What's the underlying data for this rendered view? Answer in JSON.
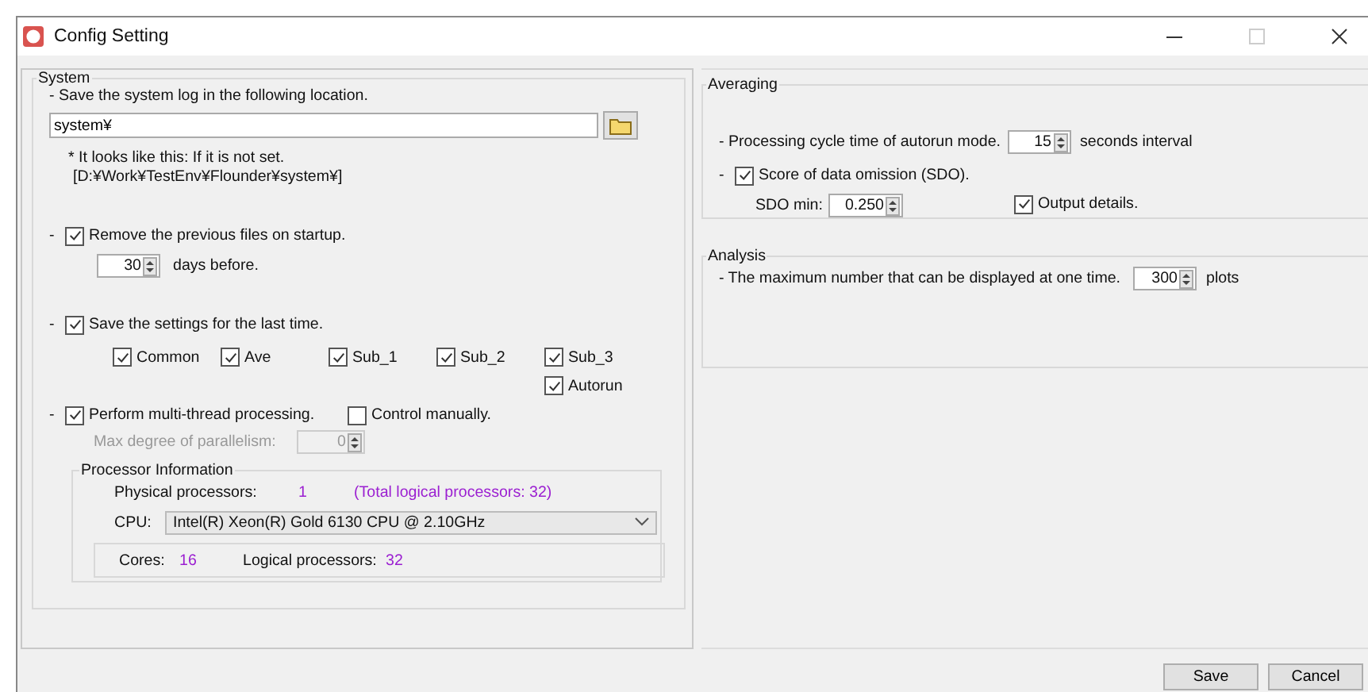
{
  "window": {
    "title": "Config Setting"
  },
  "system": {
    "title": "System",
    "log_label": "- Save the system log in the following location.",
    "log_path": "system¥",
    "note": [
      "* It looks like this: If it is not set.",
      "[D:¥Work¥TestEnv¥Flounder¥system¥]"
    ],
    "dash": "-",
    "remove_previous": {
      "label": "Remove the previous files on startup.",
      "checked": true
    },
    "days": {
      "value": "30",
      "label": "days before."
    },
    "save_settings": {
      "label": "Save the settings for the last time.",
      "checked": true
    },
    "save_items": [
      {
        "label": "Common",
        "checked": true
      },
      {
        "label": "Ave",
        "checked": true
      },
      {
        "label": "Sub_1",
        "checked": true
      },
      {
        "label": "Sub_2",
        "checked": true
      },
      {
        "label": "Sub_3",
        "checked": true
      },
      {
        "label": "Autorun",
        "checked": true
      }
    ],
    "multi_thread": {
      "label": "Perform multi-thread processing.",
      "checked": true
    },
    "control_manually": {
      "label": "Control manually.",
      "checked": false
    },
    "max_parallel": {
      "label": "Max degree of parallelism:",
      "value": "0",
      "disabled": true
    },
    "processor_info": {
      "title": "Processor Information",
      "physical_label": "Physical processors:",
      "physical_value": "1",
      "total_logical": "(Total logical processors: 32)",
      "cpu_label": "CPU:",
      "cpu_value": "Intel(R) Xeon(R) Gold 6130 CPU @ 2.10GHz",
      "cores_label": "Cores:",
      "cores_value": "16",
      "logical_label": "Logical processors:",
      "logical_value": "32"
    }
  },
  "averaging": {
    "title": "Averaging",
    "cycle_label": "- Processing cycle time of autorun mode.",
    "cycle_value": "15",
    "cycle_unit": "seconds interval",
    "dash": "-",
    "sdo": {
      "label": "Score of data omission (SDO).",
      "checked": true
    },
    "sdo_min_label": "SDO min:",
    "sdo_min_value": "0.250",
    "output_details": {
      "label": "Output details.",
      "checked": true
    }
  },
  "analysis": {
    "title": "Analysis",
    "max_label": "- The maximum number that can be displayed at one time.",
    "max_value": "300",
    "unit": "plots"
  },
  "buttons": [
    "Save",
    "Cancel"
  ]
}
